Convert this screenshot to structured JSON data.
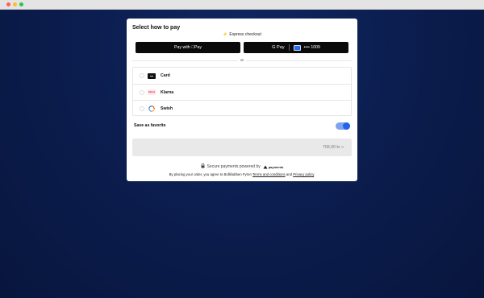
{
  "checkout": {
    "title": "Select how to pay",
    "express_label": "Express checkout",
    "express_icon": "lightning-icon",
    "apple_pay_label": "Pay with Pay",
    "google_pay": {
      "brand": "G Pay",
      "masked_card": "•••• 1009"
    },
    "divider_label": "or",
    "methods": [
      {
        "label": "Card",
        "icon": "credit-card-icon"
      },
      {
        "label": "Klarna",
        "icon": "klarna-icon",
        "icon_text": "Klarna"
      },
      {
        "label": "Swish",
        "icon": "swish-icon"
      }
    ],
    "favorite_label": "Save as favorite",
    "favorite_enabled": true,
    "pay_button_label": "709,00 kr »",
    "secure_text": "Secure payments powered by",
    "provider_name": "payments",
    "terms": {
      "prefix": "By placing your order, you agree to Bollklubben Fyren",
      "terms_link": "Terms and conditions",
      "and": "and",
      "privacy_link": "Privacy policy",
      "suffix": "."
    }
  },
  "colors": {
    "background": "#0b1d4e",
    "accent": "#2463e6",
    "button_dark": "#0a0a0a"
  }
}
